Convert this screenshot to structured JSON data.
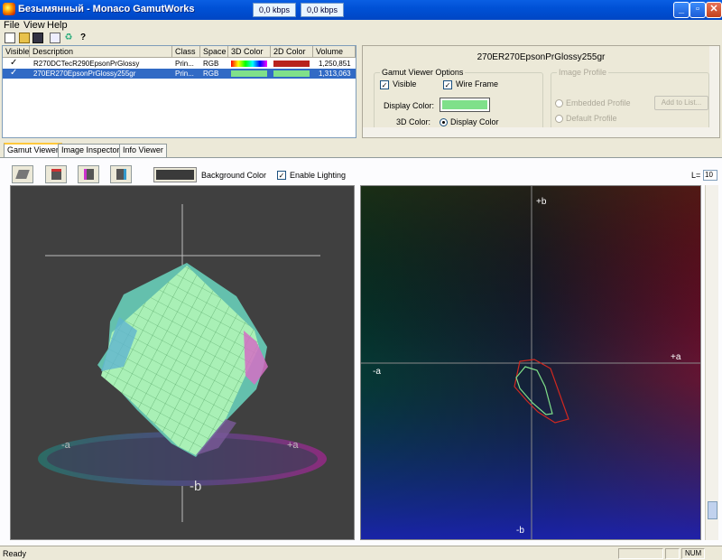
{
  "window": {
    "title": "Безымянный - Monaco GamutWorks",
    "kbps_a": "0,0 kbps",
    "kbps_b": "0,0 kbps"
  },
  "menu": [
    "File",
    "View",
    "Help"
  ],
  "table": {
    "headers": [
      "Visible",
      "Description",
      "Class",
      "Space",
      "3D Color",
      "2D Color",
      "Volume"
    ],
    "rows": [
      {
        "visible": "✓",
        "description": "R270DCTecR290EpsonPrGlossy",
        "class": "Prin...",
        "space": "RGB",
        "volume": "1,250,851",
        "color2d": "#b8231e"
      },
      {
        "visible": "✓",
        "description": "270ER270EpsonPrGlossy255gr",
        "class": "Prin...",
        "space": "RGB",
        "volume": "1,313,063",
        "color2d": "#7fe08a",
        "selected": true
      }
    ]
  },
  "options": {
    "profile_name": "270ER270EpsonPrGlossy255gr",
    "gvo_title": "Gamut Viewer Options",
    "visible_label": "Visible",
    "wireframe_label": "Wire Frame",
    "display_color_label": "Display Color:",
    "display_color": "#7fe08a",
    "color3d_label": "3D Color:",
    "color3d_option": "Display Color",
    "image_profile_title": "Image Profile",
    "embedded_label": "Embedded Profile",
    "default_label": "Default Profile",
    "add_to_list": "Add to List..."
  },
  "tabs": [
    "Gamut Viewer",
    "Image Inspector",
    "Info Viewer"
  ],
  "viewer": {
    "background_color_label": "Background Color",
    "lighting_label": "Enable Lighting",
    "background_color": "#3a3a3a",
    "l_label": "L=",
    "l_value": "10"
  },
  "plot3d": {
    "label_minus_a": "-a",
    "label_plus_a": "+a",
    "label_minus_b": "-b"
  },
  "plot2d": {
    "plus_b": "+b",
    "minus_b": "-b",
    "plus_a": "+a",
    "minus_a": "-a"
  },
  "status": {
    "text": "Ready",
    "num": "NUM"
  }
}
